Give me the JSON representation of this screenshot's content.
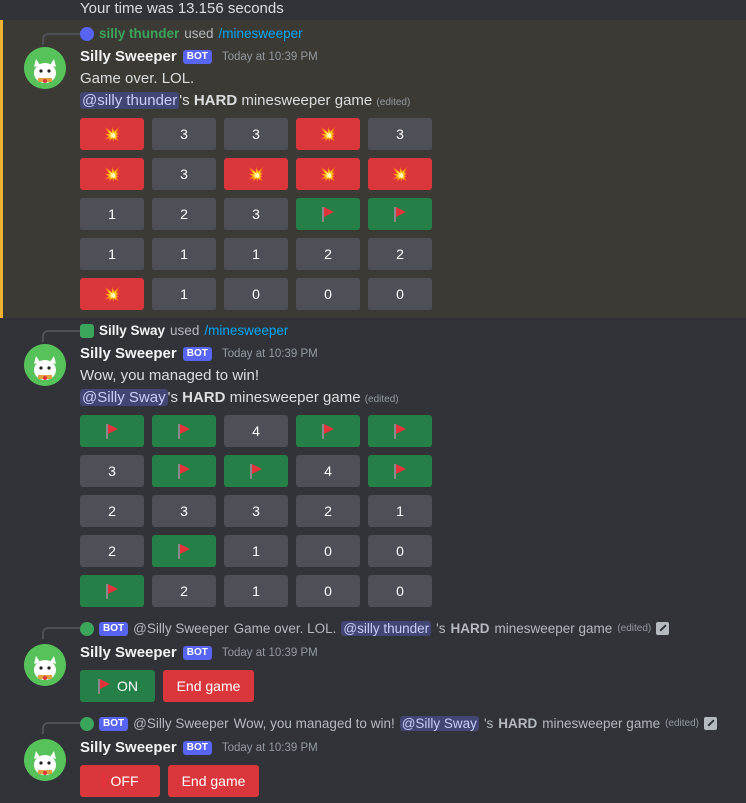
{
  "top_text": "Your time was 13.156 seconds",
  "colors": {
    "flag": "#248046",
    "bomb": "#da373c",
    "number": "#4e5058",
    "highlight": "#f0b232",
    "command": "#00a8fc"
  },
  "msg1": {
    "reply_user": "silly thunder",
    "reply_used": "used",
    "reply_command": "/minesweeper",
    "author": "Silly Sweeper",
    "bot": "BOT",
    "time": "Today at 10:39 PM",
    "line1": "Game over. LOL.",
    "mention": "@silly thunder",
    "line2_post": "'s",
    "hard": "HARD",
    "game": "minesweeper game",
    "edited": "(edited)",
    "grid": [
      [
        {
          "t": "bomb",
          "v": "💥"
        },
        {
          "t": "num",
          "v": "3"
        },
        {
          "t": "num",
          "v": "3"
        },
        {
          "t": "bomb",
          "v": "💥"
        },
        {
          "t": "num",
          "v": "3"
        }
      ],
      [
        {
          "t": "bomb",
          "v": "💥"
        },
        {
          "t": "num",
          "v": "3"
        },
        {
          "t": "bomb",
          "v": "💥"
        },
        {
          "t": "bomb",
          "v": "💥"
        },
        {
          "t": "bomb",
          "v": "💥"
        }
      ],
      [
        {
          "t": "num",
          "v": "1"
        },
        {
          "t": "num",
          "v": "2"
        },
        {
          "t": "num",
          "v": "3"
        },
        {
          "t": "flag",
          "v": ""
        },
        {
          "t": "flag",
          "v": ""
        }
      ],
      [
        {
          "t": "num",
          "v": "1"
        },
        {
          "t": "num",
          "v": "1"
        },
        {
          "t": "num",
          "v": "1"
        },
        {
          "t": "num",
          "v": "2"
        },
        {
          "t": "num",
          "v": "2"
        }
      ],
      [
        {
          "t": "bomb",
          "v": "💥"
        },
        {
          "t": "num",
          "v": "1"
        },
        {
          "t": "num",
          "v": "0"
        },
        {
          "t": "num",
          "v": "0"
        },
        {
          "t": "num",
          "v": "0"
        }
      ]
    ]
  },
  "msg2": {
    "reply_user": "Silly Sway",
    "reply_used": "used",
    "reply_command": "/minesweeper",
    "author": "Silly Sweeper",
    "bot": "BOT",
    "time": "Today at 10:39 PM",
    "line1": "Wow, you managed to win!",
    "mention": "@Silly Sway",
    "line2_post": "'s",
    "hard": "HARD",
    "game": "minesweeper game",
    "edited": "(edited)",
    "grid": [
      [
        {
          "t": "flag",
          "v": ""
        },
        {
          "t": "flag",
          "v": ""
        },
        {
          "t": "num",
          "v": "4"
        },
        {
          "t": "flag",
          "v": ""
        },
        {
          "t": "flag",
          "v": ""
        }
      ],
      [
        {
          "t": "num",
          "v": "3"
        },
        {
          "t": "flag",
          "v": ""
        },
        {
          "t": "flag",
          "v": ""
        },
        {
          "t": "num",
          "v": "4"
        },
        {
          "t": "flag",
          "v": ""
        }
      ],
      [
        {
          "t": "num",
          "v": "2"
        },
        {
          "t": "num",
          "v": "3"
        },
        {
          "t": "num",
          "v": "3"
        },
        {
          "t": "num",
          "v": "2"
        },
        {
          "t": "num",
          "v": "1"
        }
      ],
      [
        {
          "t": "num",
          "v": "2"
        },
        {
          "t": "flag",
          "v": ""
        },
        {
          "t": "num",
          "v": "1"
        },
        {
          "t": "num",
          "v": "0"
        },
        {
          "t": "num",
          "v": "0"
        }
      ],
      [
        {
          "t": "flag",
          "v": ""
        },
        {
          "t": "num",
          "v": "2"
        },
        {
          "t": "num",
          "v": "1"
        },
        {
          "t": "num",
          "v": "0"
        },
        {
          "t": "num",
          "v": "0"
        }
      ]
    ]
  },
  "msg3": {
    "reply_bot": "BOT",
    "reply_author": "@Silly Sweeper",
    "reply_text": "Game over. LOL.",
    "reply_mention": "@silly thunder",
    "reply_post": "'s",
    "reply_hard": "HARD",
    "reply_game": "minesweeper game",
    "reply_edited": "(edited)",
    "author": "Silly Sweeper",
    "bot": "BOT",
    "time": "Today at 10:39 PM",
    "toggle_label": "ON",
    "end_label": "End game"
  },
  "msg4": {
    "reply_bot": "BOT",
    "reply_author": "@Silly Sweeper",
    "reply_text": "Wow, you managed to win!",
    "reply_mention": "@Silly Sway",
    "reply_post": "'s",
    "reply_hard": "HARD",
    "reply_game": "minesweeper game",
    "reply_edited": "(edited)",
    "author": "Silly Sweeper",
    "bot": "BOT",
    "time": "Today at 10:39 PM",
    "toggle_label": "OFF",
    "end_label": "End game"
  }
}
